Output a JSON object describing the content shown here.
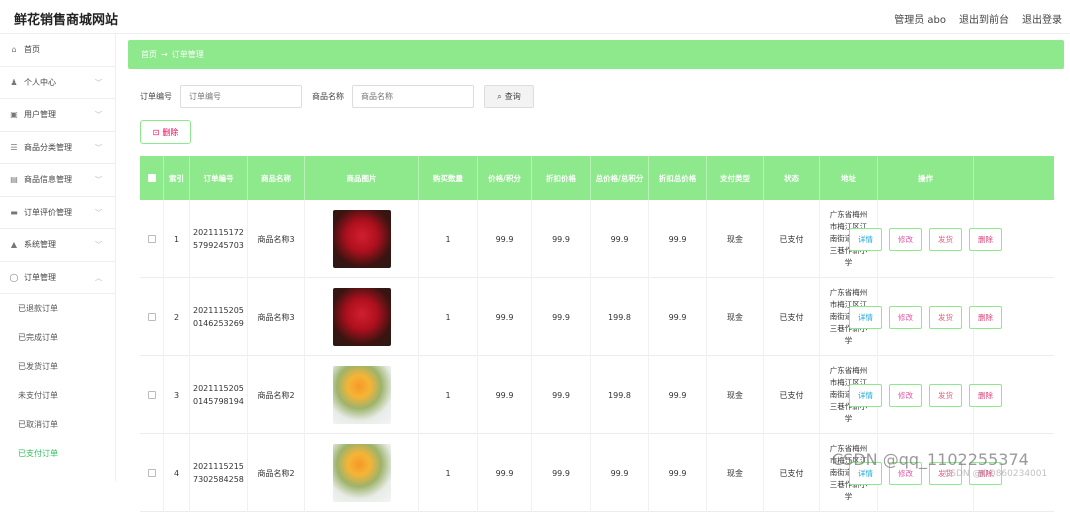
{
  "app": {
    "title": "鲜花销售商城网站"
  },
  "topbar": {
    "user": "管理员 abo",
    "front": "退出到前台",
    "logout": "退出登录"
  },
  "sidebar": {
    "items": [
      {
        "icon": "home-icon",
        "glyph": "⌂",
        "label": "首页",
        "chevron": false
      },
      {
        "icon": "user-icon",
        "glyph": "♟",
        "label": "个人中心",
        "chevron": true
      },
      {
        "icon": "users-icon",
        "glyph": "▣",
        "label": "用户管理",
        "chevron": true
      },
      {
        "icon": "category-icon",
        "glyph": "☰",
        "label": "商品分类管理",
        "chevron": true
      },
      {
        "icon": "product-icon",
        "glyph": "▤",
        "label": "商品信息管理",
        "chevron": true
      },
      {
        "icon": "review-icon",
        "glyph": "▬",
        "label": "订单评价管理",
        "chevron": true
      },
      {
        "icon": "system-icon",
        "glyph": "▲",
        "label": "系统管理",
        "chevron": true
      },
      {
        "icon": "order-icon",
        "glyph": "◯",
        "label": "订单管理",
        "chevron": true
      }
    ],
    "sub_items": [
      {
        "label": "已退款订单",
        "active": false
      },
      {
        "label": "已完成订单",
        "active": false
      },
      {
        "label": "已发货订单",
        "active": false
      },
      {
        "label": "未支付订单",
        "active": false
      },
      {
        "label": "已取消订单",
        "active": false
      },
      {
        "label": "已支付订单",
        "active": true
      }
    ]
  },
  "breadcrumb": {
    "home": "首页",
    "sep": "→",
    "current": "订单管理"
  },
  "search": {
    "order_label": "订单编号",
    "order_placeholder": "订单编号",
    "product_label": "商品名称",
    "product_placeholder": "商品名称",
    "query": "查询"
  },
  "actions": {
    "delete": "删除"
  },
  "table": {
    "headers": [
      "索引",
      "订单编号",
      "商品名称",
      "商品图片",
      "购买数量",
      "价格/积分",
      "折扣价格",
      "总价格/总积分",
      "折扣总价格",
      "支付类型",
      "状态",
      "地址",
      "操作"
    ],
    "ops": {
      "detail": "详情",
      "edit": "修改",
      "ship": "发货",
      "delete": "删除"
    },
    "rows": [
      {
        "index": "1",
        "order_no_a": "2021115172",
        "order_no_b": "5799245703",
        "name": "商品名称3",
        "image": "rose",
        "qty": "1",
        "price": "99.9",
        "discount": "99.9",
        "total": "99.9",
        "discount_total": "99.9",
        "pay": "现金",
        "status": "已支付",
        "address": "广东省梅州市梅江区江南街道白马三巷作新小学"
      },
      {
        "index": "2",
        "order_no_a": "2021115205",
        "order_no_b": "0146253269",
        "name": "商品名称3",
        "image": "rose",
        "qty": "1",
        "price": "99.9",
        "discount": "99.9",
        "total": "199.8",
        "discount_total": "99.9",
        "pay": "现金",
        "status": "已支付",
        "address": "广东省梅州市梅江区江南街道白马三巷作新小学"
      },
      {
        "index": "3",
        "order_no_a": "2021115205",
        "order_no_b": "0145798194",
        "name": "商品名称2",
        "image": "sunflower",
        "qty": "1",
        "price": "99.9",
        "discount": "99.9",
        "total": "199.8",
        "discount_total": "99.9",
        "pay": "现金",
        "status": "已支付",
        "address": "广东省梅州市梅江区江南街道白马三巷作新小学"
      },
      {
        "index": "4",
        "order_no_a": "2021115215",
        "order_no_b": "7302584258",
        "name": "商品名称2",
        "image": "sunflower",
        "qty": "1",
        "price": "99.9",
        "discount": "99.9",
        "total": "99.9",
        "discount_total": "99.9",
        "pay": "现金",
        "status": "已支付",
        "address": "广东省梅州市梅江区江南街道白马三巷作新小学"
      }
    ]
  },
  "watermark": {
    "main": "CSDN @qq_1102255374",
    "sub": "CSDN @QQ860234001"
  },
  "colors": {
    "accent": "#8ee98c",
    "active_link": "#2dc25a"
  }
}
